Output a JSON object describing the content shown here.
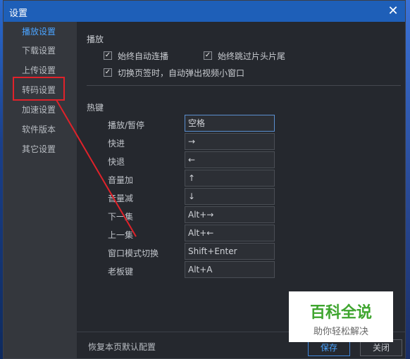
{
  "window": {
    "title": "设置",
    "close_glyph": "✕"
  },
  "sidebar": {
    "items": [
      {
        "label": "播放设置"
      },
      {
        "label": "下载设置"
      },
      {
        "label": "上传设置"
      },
      {
        "label": "转码设置"
      },
      {
        "label": "加速设置"
      },
      {
        "label": "软件版本"
      },
      {
        "label": "其它设置"
      }
    ]
  },
  "playback": {
    "section_title": "播放",
    "options": [
      {
        "label": "始终自动连播",
        "checked": true
      },
      {
        "label": "始终跳过片头片尾",
        "checked": true
      },
      {
        "label": "切换页签时，自动弹出视频小窗口",
        "checked": true
      }
    ]
  },
  "hotkeys": {
    "section_title": "热键",
    "items": [
      {
        "label": "播放/暂停",
        "value": "空格"
      },
      {
        "label": "快进",
        "value": "→"
      },
      {
        "label": "快退",
        "value": "←"
      },
      {
        "label": "音量加",
        "value": "↑"
      },
      {
        "label": "音量减",
        "value": "↓"
      },
      {
        "label": "下一集",
        "value": "Alt+→"
      },
      {
        "label": "上一集",
        "value": "Alt+←"
      },
      {
        "label": "窗口模式切换",
        "value": "Shift+Enter"
      },
      {
        "label": "老板键",
        "value": "Alt+A"
      }
    ]
  },
  "footer": {
    "restore_label": "恢复本页默认配置",
    "save_label": "保存",
    "close_label": "关闭"
  },
  "watermark": {
    "title": "百科全说",
    "subtitle": "助你轻松解决"
  },
  "colors": {
    "titlebar": "#1e5fb8",
    "accent": "#4aa3ff",
    "annotation": "#e0222a",
    "watermark_green": "#3ea52e"
  },
  "checkbox_glyph": "✓"
}
